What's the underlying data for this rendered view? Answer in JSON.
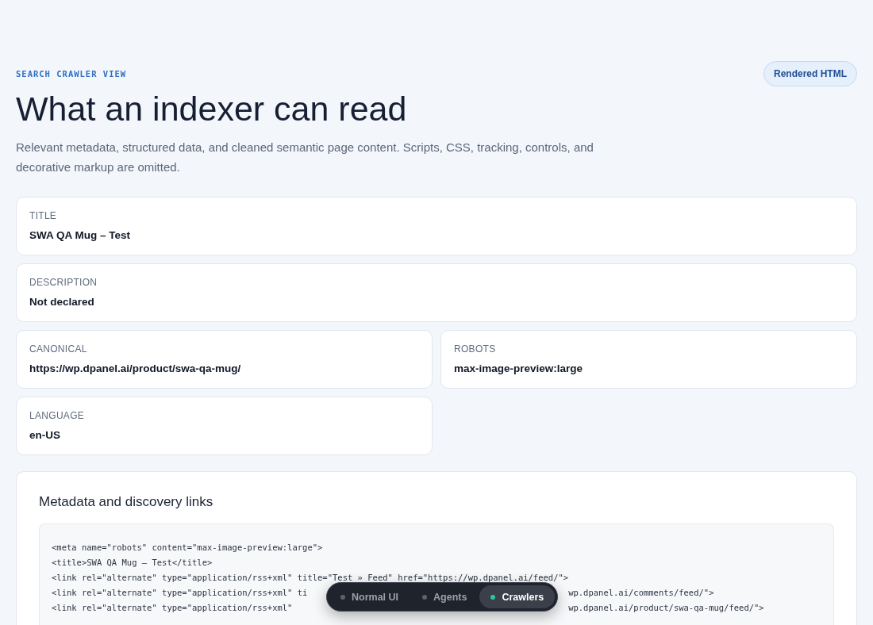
{
  "header": {
    "eyebrow": "SEARCH CRAWLER VIEW",
    "title": "What an indexer can read",
    "description": "Relevant metadata, structured data, and cleaned semantic page content. Scripts, CSS, tracking, controls, and decorative markup are omitted.",
    "badge": "Rendered HTML"
  },
  "summary_fields": [
    {
      "label": "TITLE",
      "value": "SWA QA Mug – Test"
    },
    {
      "label": "DESCRIPTION",
      "value": "Not declared"
    }
  ],
  "detail_fields": [
    {
      "label": "CANONICAL",
      "value": "https://wp.dpanel.ai/product/swa-qa-mug/"
    },
    {
      "label": "ROBOTS",
      "value": "max-image-preview:large"
    },
    {
      "label": "LANGUAGE",
      "value": "en-US"
    }
  ],
  "links_panel": {
    "title": "Metadata and discovery links",
    "lines": [
      {
        "text": "<meta name=\"robots\" content=\"max-image-preview:large\">"
      },
      {
        "text": "<title>SWA QA Mug – Test</title>"
      },
      {
        "text": "<link rel=\"alternate\" type=\"application/rss+xml\" title=\"Test » Feed\" href=\"https://wp.dpanel.ai/feed/\">"
      },
      {
        "text": "<link rel=\"alternate\" type=\"application/rss+xml\" ti",
        "tail": "wp.dpanel.ai/comments/feed/\">"
      },
      {
        "text": "<link rel=\"alternate\" type=\"application/rss+xml\" ",
        "tail": "wp.dpanel.ai/product/swa-qa-mug/feed/\">"
      }
    ]
  },
  "view_switcher": [
    {
      "label": "Normal UI",
      "selected": false
    },
    {
      "label": "Agents",
      "selected": false
    },
    {
      "label": "Crawlers",
      "selected": true
    }
  ]
}
